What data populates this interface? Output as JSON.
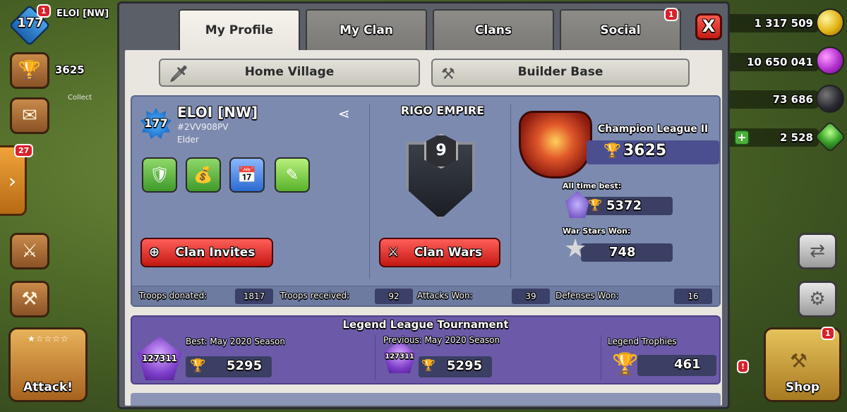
{
  "hud_left": {
    "player_level": "177",
    "player_name": "ELOI [NW]",
    "player_notif": "1",
    "trophies": "3625",
    "collect_label": "Collect",
    "side_notif": "27",
    "attack_label": "Attack!"
  },
  "hud_right": {
    "gold": "1 317 509",
    "elixir": "10 650 041",
    "dark_elixir": "73 686",
    "gems": "2 528",
    "shop_label": "Shop",
    "shop_notif": "1",
    "misc_notif": "!"
  },
  "tabs": [
    {
      "label": "My Profile",
      "active": true
    },
    {
      "label": "My Clan",
      "active": false
    },
    {
      "label": "Clans",
      "active": false
    },
    {
      "label": "Social",
      "active": false
    }
  ],
  "social_notif": "1",
  "close_label": "X",
  "village": {
    "home": "Home Village",
    "builder": "Builder Base"
  },
  "profile": {
    "level": "177",
    "name": "ELOI [NW]",
    "tag": "#2VV908PV",
    "role": "Elder",
    "clan_invites_label": "Clan Invites"
  },
  "clan": {
    "name": "RIGO EMPIRE",
    "level": "9",
    "clan_wars_label": "Clan Wars"
  },
  "league": {
    "name": "Champion League II",
    "trophies": "3625",
    "all_time_label": "All time best:",
    "all_time_value": "5372",
    "war_stars_label": "War Stars Won:",
    "war_stars_value": "748"
  },
  "stats": [
    {
      "label": "Troops donated:",
      "value": "1817"
    },
    {
      "label": "Troops received:",
      "value": "92"
    },
    {
      "label": "Attacks Won:",
      "value": "39"
    },
    {
      "label": "Defenses Won:",
      "value": "16"
    }
  ],
  "tournament": {
    "title": "Legend League Tournament",
    "best_label": "Best: May 2020 Season",
    "best_rank": "127311",
    "best_trophies": "5295",
    "previous_label": "Previous: May 2020 Season",
    "previous_rank": "127311",
    "previous_trophies": "5295",
    "legend_label": "Legend Trophies",
    "legend_value": "461"
  },
  "colors": {
    "panel_bg": "#e8e6df",
    "profile_card": "#7d8ab0",
    "tournament_bg": "#6c5aa8",
    "red_button": "#d9261e",
    "trophy_gold": "#f2c230"
  },
  "icons": [
    "sword-icon",
    "axes-icon",
    "share-icon",
    "search-icon",
    "swords-icon",
    "trophy-icon",
    "star-icon",
    "gear-icon",
    "hammer-icon",
    "chevron-right-icon",
    "mail-icon"
  ]
}
